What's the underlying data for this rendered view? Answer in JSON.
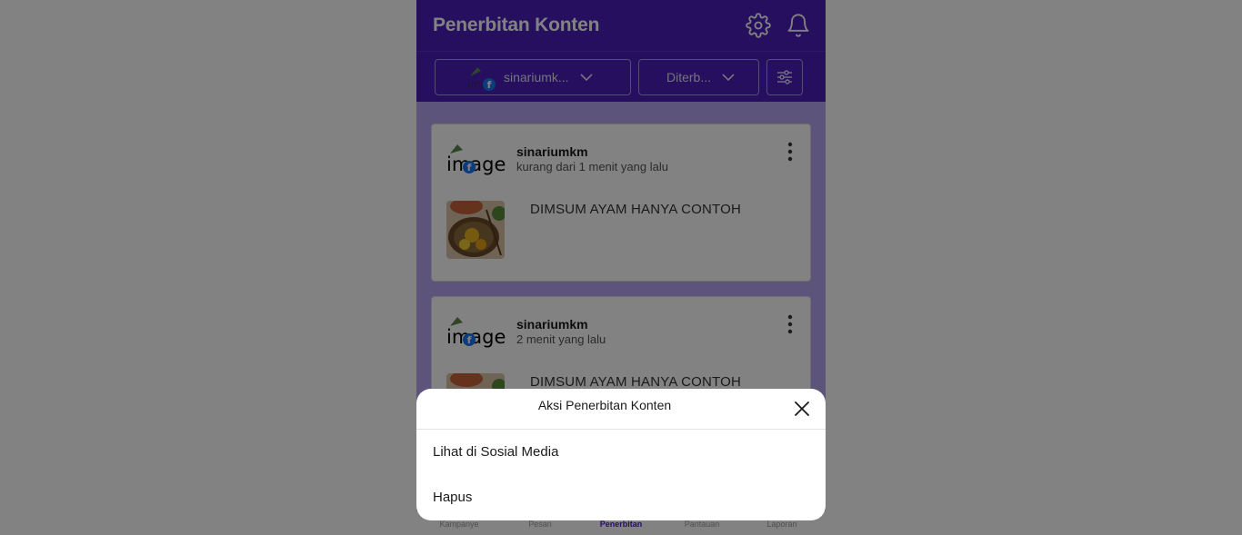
{
  "header": {
    "title": "Penerbitan Konten",
    "icons": [
      "gear-icon",
      "bell-icon"
    ]
  },
  "filters": {
    "account": {
      "label": "sinariumk...",
      "avatar_alt": "image"
    },
    "status": {
      "label": "Diterb..."
    },
    "settings_icon": "sliders-icon"
  },
  "posts": [
    {
      "username": "sinariumkm",
      "time": "kurang dari 1 menit yang lalu",
      "avatar_alt": "image",
      "text": "DIMSUM AYAM HANYA CONTOH"
    },
    {
      "username": "sinariumkm",
      "time": "2 menit yang lalu",
      "avatar_alt": "image",
      "text": "DIMSUM AYAM HANYA CONTOH"
    }
  ],
  "bottom_nav": {
    "items": [
      "Kampanye",
      "Pesan",
      "Penerbitan",
      "Pantauan",
      "Laporan"
    ],
    "active": "Penerbitan"
  },
  "action_sheet": {
    "title": "Aksi Penerbitan Konten",
    "items": [
      "Lihat di Sosial Media",
      "Hapus"
    ]
  },
  "colors": {
    "brand_purple": "#4a1fb8",
    "content_bg": "#b6a6f2",
    "facebook_blue": "#1877f2"
  }
}
